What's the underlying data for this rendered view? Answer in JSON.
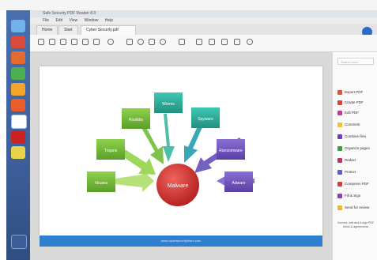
{
  "window": {
    "title": "Safe Security PDF Reader 8.0"
  },
  "menu": [
    "File",
    "Edit",
    "View",
    "Window",
    "Help"
  ],
  "tabs": [
    {
      "label": "Home"
    },
    {
      "label": "Start"
    },
    {
      "label": "Cyber Security.pdf"
    }
  ],
  "diagram": {
    "center": "Malware",
    "nodes": [
      "Viruses",
      "Trojans",
      "Rootkits",
      "Worms",
      "Spyware",
      "Ransomware",
      "Adware"
    ]
  },
  "page_footer": "www.cybersecurityteam.com",
  "side_panel": {
    "search_placeholder": "Search tools",
    "items": [
      "Export PDF",
      "Create PDF",
      "Edit PDF",
      "Comment",
      "Combine files",
      "Organize pages",
      "Redact",
      "Protect",
      "Compress PDF",
      "Fill & Sign",
      "Send for review"
    ],
    "footer": "Convert, edit and e-sign PDF forms & agreements"
  },
  "colors": {
    "accent": "#2f7fcf",
    "center": "#c62a2a",
    "node_green": "#7cbf3b",
    "node_teal": "#2fae9e",
    "node_purple": "#6c4fb8"
  },
  "icons": [
    "home-icon",
    "save-icon",
    "print-icon",
    "search-icon",
    "cursor-icon",
    "hand-icon",
    "zoom-icon",
    "comment-icon",
    "pen-icon",
    "undo-icon",
    "share-icon"
  ]
}
